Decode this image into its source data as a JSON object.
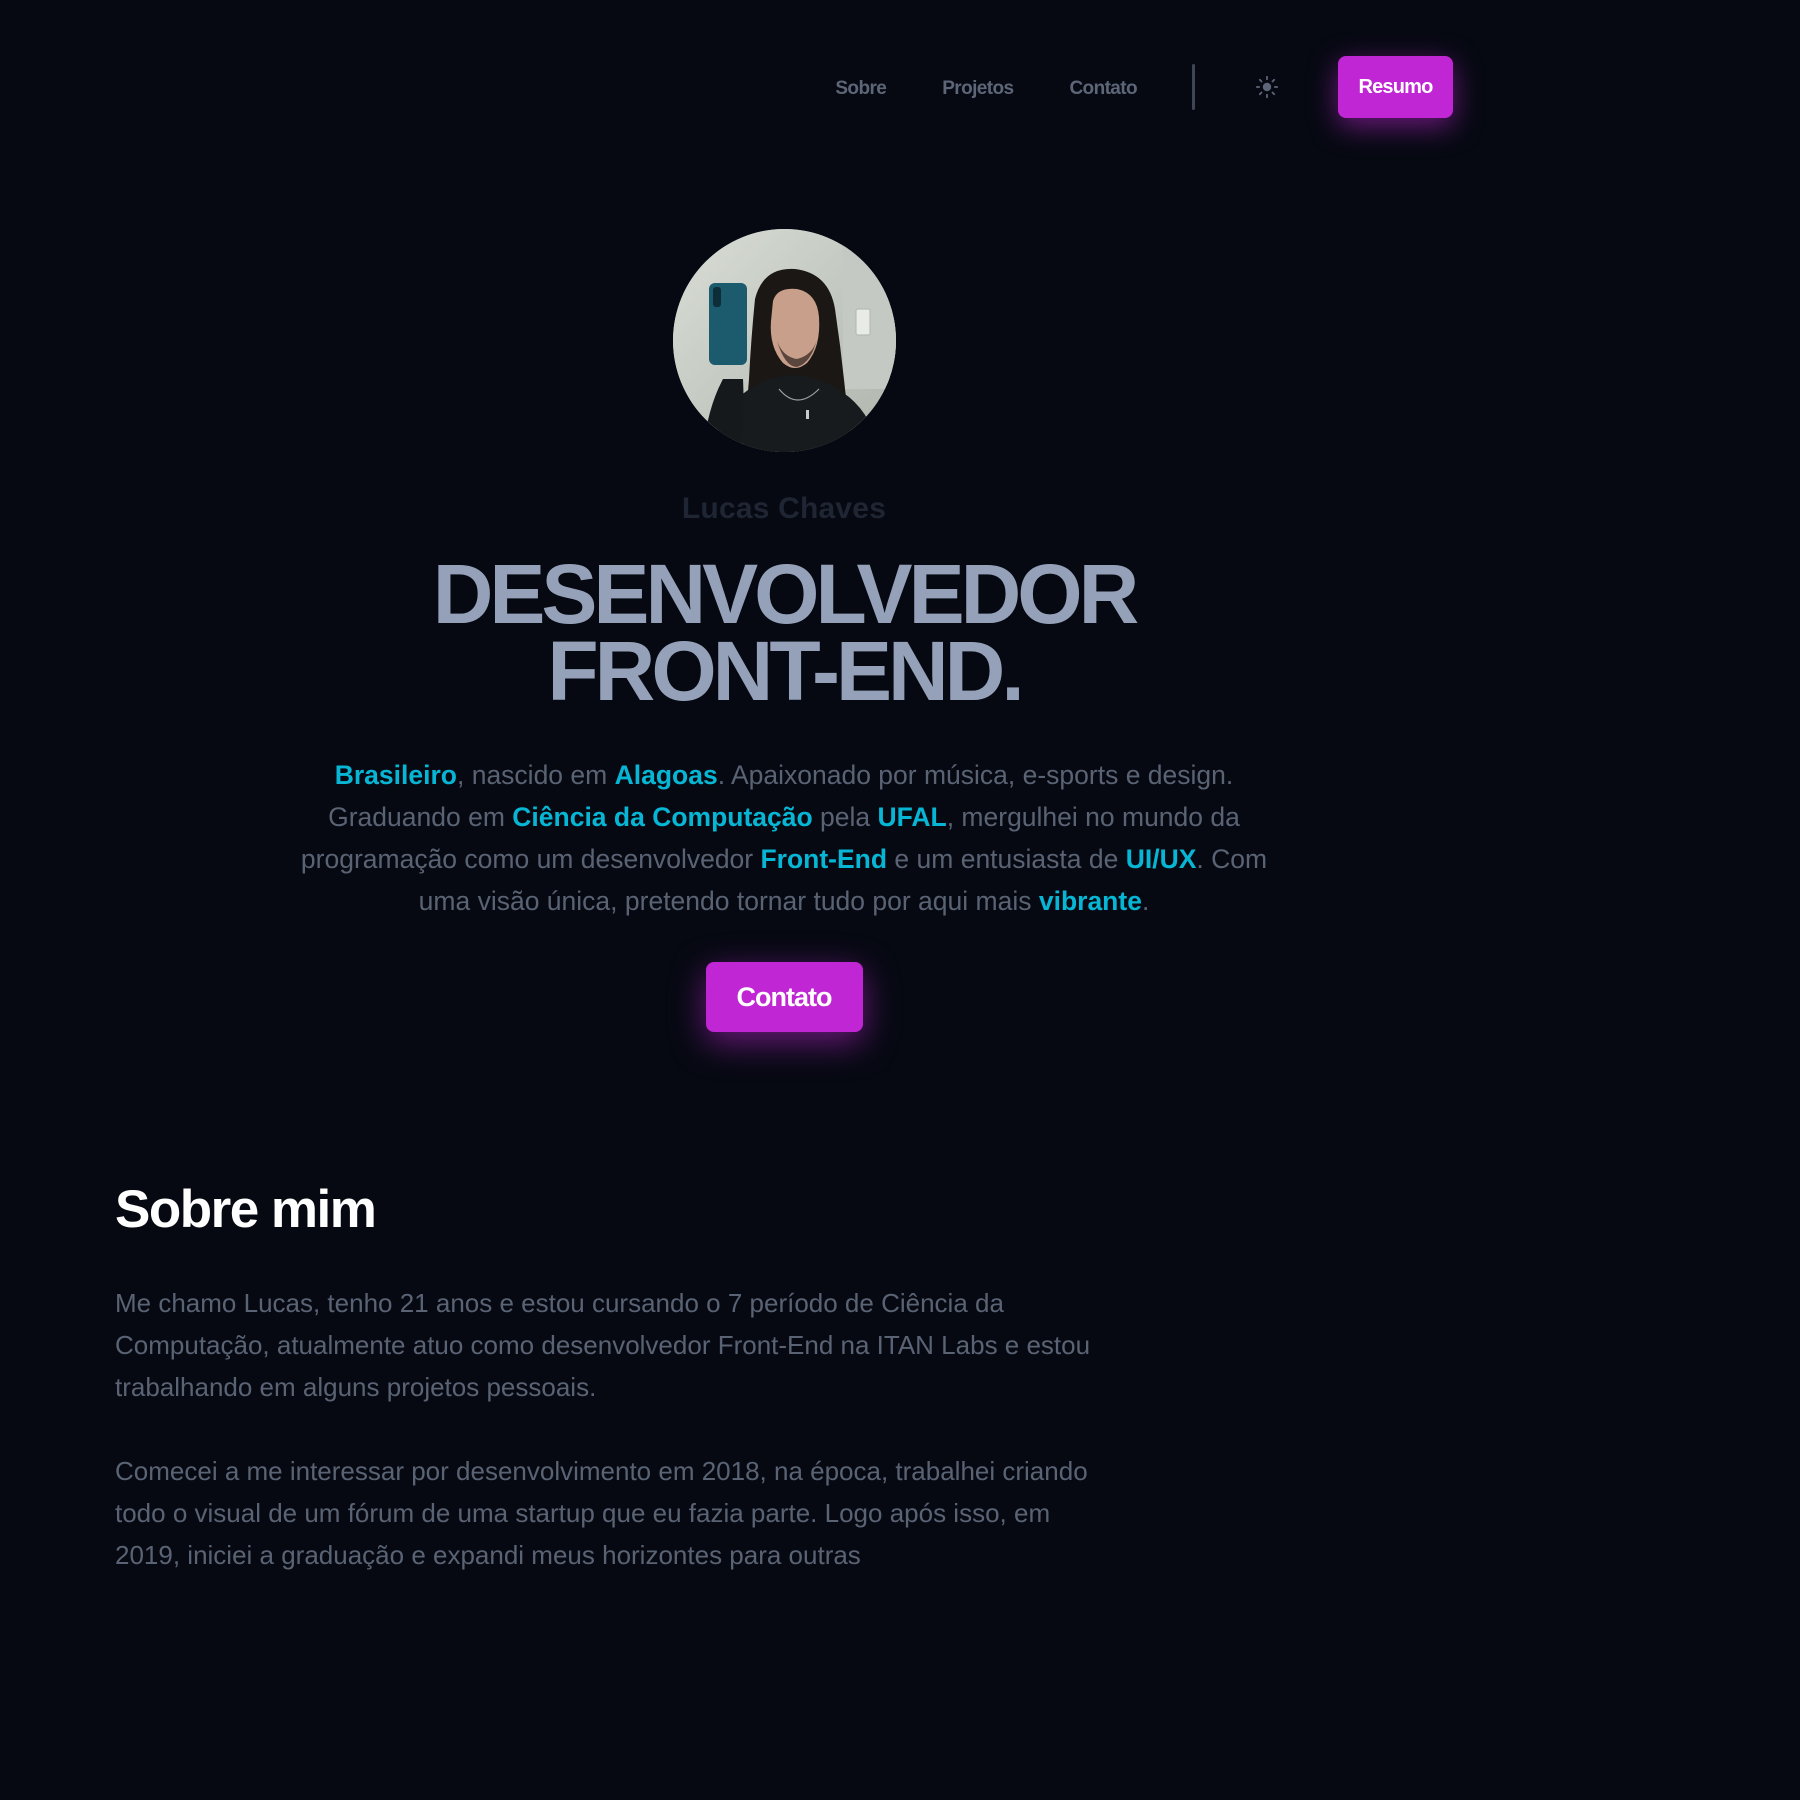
{
  "colors": {
    "background": "#060912",
    "accent": "#c026d3",
    "highlight": "#06b6d4",
    "title": "#94a1b9",
    "muted_text": "#5a6374"
  },
  "nav": {
    "links": [
      "Sobre",
      "Projetos",
      "Contato"
    ],
    "theme_icon": "sun-icon",
    "resume_label": "Resumo"
  },
  "hero": {
    "avatar_alt": "avatar",
    "name": "Lucas Chaves",
    "title_line1": "DESENVOLVEDOR",
    "title_line2": "FRONT-END.",
    "bio": {
      "s1": "Brasileiro",
      "s2": ", nascido em ",
      "s3": "Alagoas",
      "s4": ". Apaixonado por música, e-sports e design. Graduando em ",
      "s5": "Ciência da Computação",
      "s6": " pela ",
      "s7": "UFAL",
      "s8": ", mergulhei no mundo da programação como um desenvolvedor ",
      "s9": "Front-End",
      "s10": " e um entusiasta de ",
      "s11": "UI/UX",
      "s12": ". Com uma visão única, pretendo tornar tudo por aqui mais ",
      "s13": "vibrante",
      "s14": "."
    },
    "contact_label": "Contato"
  },
  "about": {
    "title": "Sobre mim",
    "p1": "Me chamo Lucas, tenho 21 anos e estou cursando o 7 período de Ciência da Computação, atualmente atuo como desenvolvedor Front-End na ITAN Labs e estou trabalhando em alguns projetos pessoais.",
    "p2": "Comecei a me interessar por desenvolvimento em 2018, na época, trabalhei criando todo o visual de um fórum de uma startup que eu fazia parte. Logo após isso, em 2019, iniciei a graduação e expandi meus horizontes para outras"
  }
}
